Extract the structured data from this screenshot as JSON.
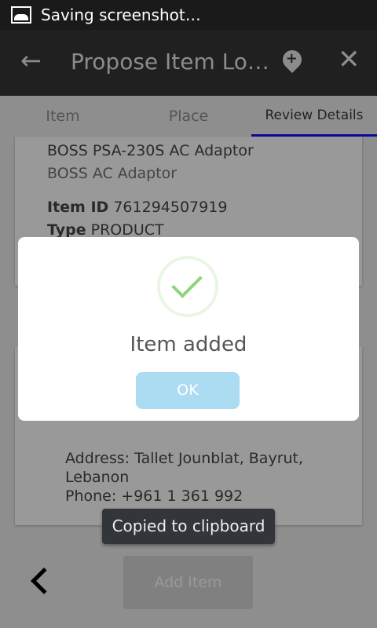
{
  "status_bar": {
    "text": "Saving screenshot…",
    "icon": "image-icon"
  },
  "action_bar": {
    "title": "Propose Item Lo…",
    "back_icon": "arrow-left-icon",
    "pin_icon": "add-location-icon",
    "close_icon": "close-icon"
  },
  "tabs": [
    {
      "label": "Item"
    },
    {
      "label": "Place"
    },
    {
      "label": "Review Details",
      "active": true
    }
  ],
  "item_card": {
    "name": "BOSS PSA-230S AC Adaptor",
    "subtitle": "BOSS AC Adaptor",
    "id_label": "Item ID",
    "id_value": "761294507919",
    "type_label": "Type",
    "type_value": "PRODUCT"
  },
  "place_card": {
    "address": "Address: Tallet Jounblat, Bayrut, Lebanon",
    "phone": "Phone: +961 1 361 992"
  },
  "dialog": {
    "title": "Item added",
    "ok_label": "OK",
    "icon": "success-check-icon"
  },
  "toast": {
    "text": "Copied to clipboard"
  },
  "footer": {
    "add_item_label": "Add Item",
    "prev_icon": "chevron-left-icon"
  },
  "colors": {
    "tab_indicator": "#0a0a9a",
    "ok_button": "#acdcf2",
    "check": "#8fd47a"
  }
}
